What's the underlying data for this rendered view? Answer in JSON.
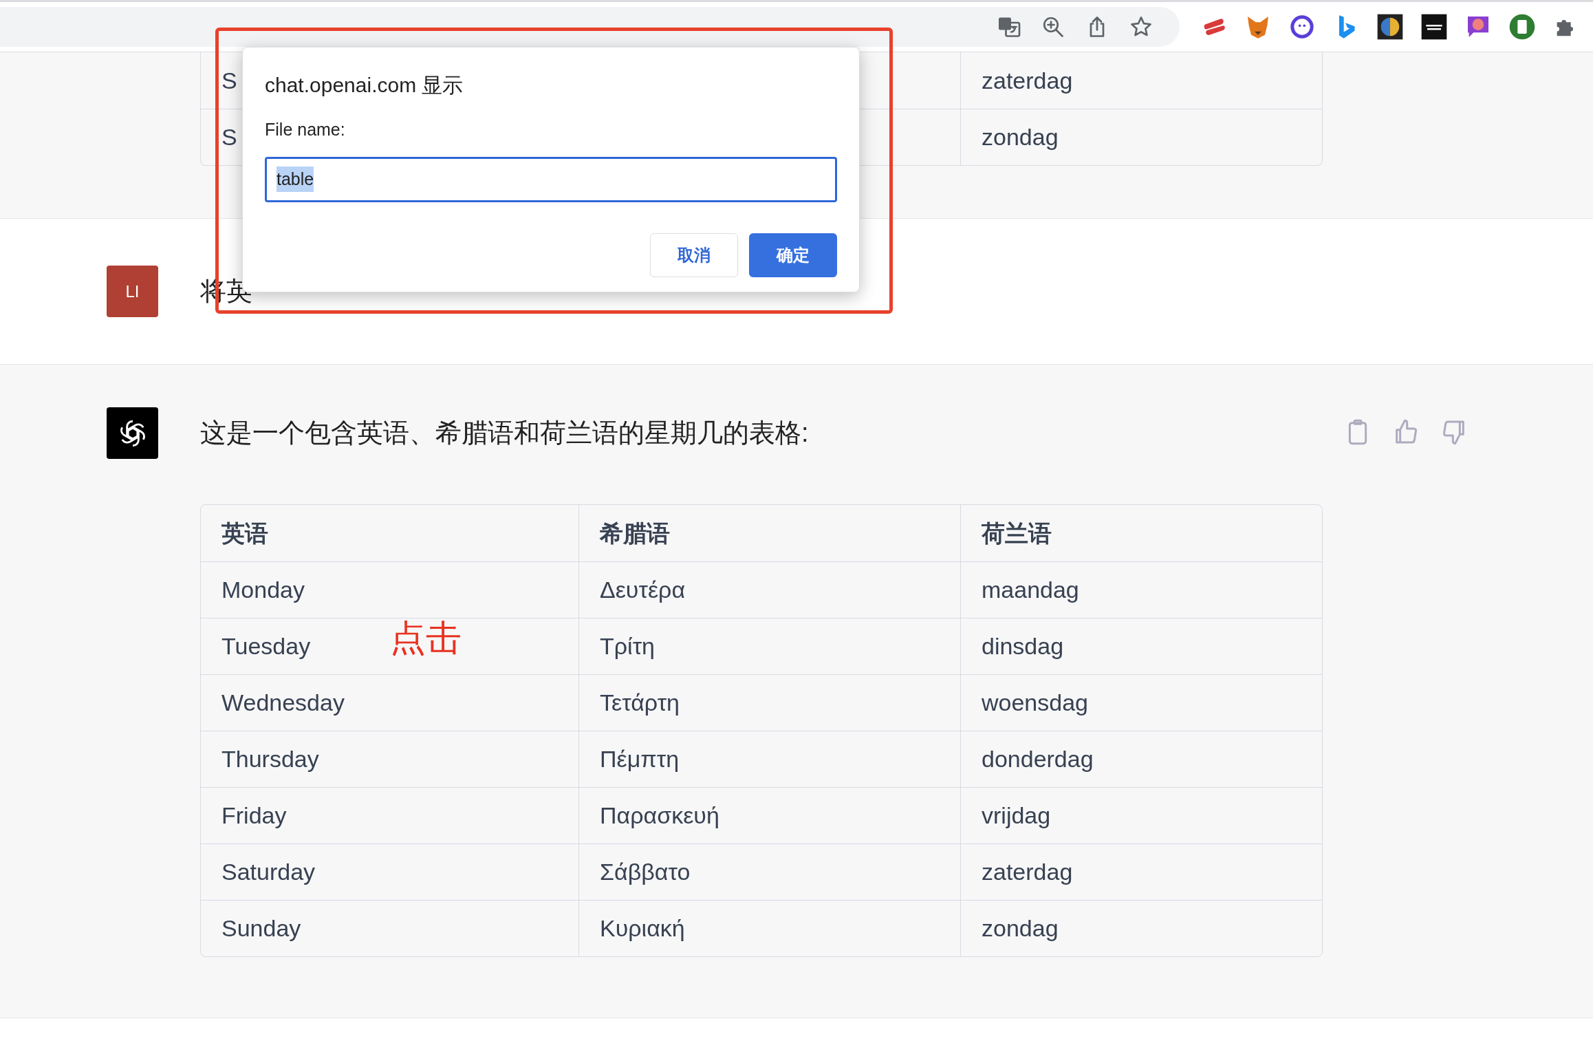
{
  "top_table": {
    "rows": [
      {
        "cells": [
          "S",
          "zaterdag"
        ]
      },
      {
        "cells": [
          "S",
          "zondag"
        ]
      }
    ]
  },
  "user_message": {
    "avatar": "LI",
    "text": "将英"
  },
  "assistant_message": {
    "text": "这是一个包含英语、希腊语和荷兰语的星期几的表格:",
    "table": {
      "columns": [
        "英语",
        "希腊语",
        "荷兰语"
      ],
      "rows": [
        [
          "Monday",
          "Δευτέρα",
          "maandag"
        ],
        [
          "Tuesday",
          "Τρίτη",
          "dinsdag"
        ],
        [
          "Wednesday",
          "Τετάρτη",
          "woensdag"
        ],
        [
          "Thursday",
          "Πέμπτη",
          "donderdag"
        ],
        [
          "Friday",
          "Παρασκευή",
          "vrijdag"
        ],
        [
          "Saturday",
          "Σάββατο",
          "zaterdag"
        ],
        [
          "Sunday",
          "Κυριακή",
          "zondag"
        ]
      ]
    }
  },
  "dialog": {
    "title": "chat.openai.com 显示",
    "label": "File name:",
    "value": "table",
    "buttons": [
      {
        "label": "取消",
        "kind": "secondary"
      },
      {
        "label": "确定",
        "kind": "primary"
      }
    ]
  },
  "annotation": {
    "text": "点击"
  }
}
